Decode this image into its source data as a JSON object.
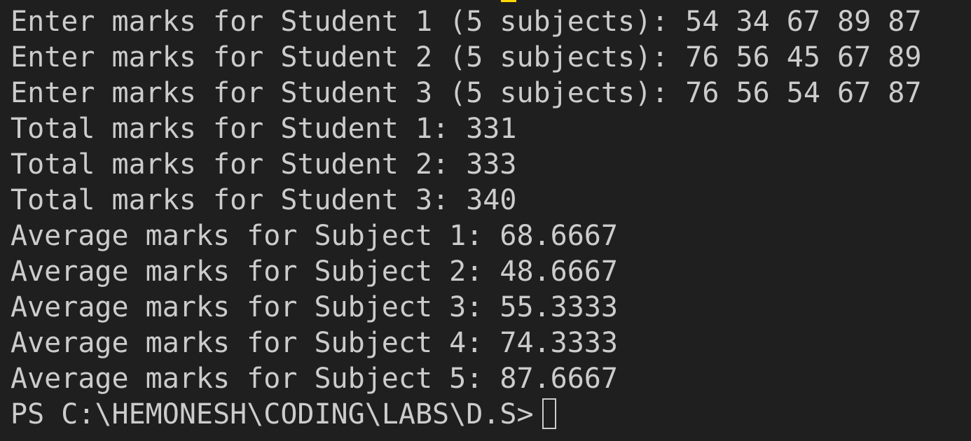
{
  "terminal": {
    "lines": [
      "Enter marks for Student 1 (5 subjects): 54 34 67 89 87",
      "Enter marks for Student 2 (5 subjects): 76 56 45 67 89",
      "Enter marks for Student 3 (5 subjects): 76 56 54 67 87",
      "Total marks for Student 1: 331",
      "Total marks for Student 2: 333",
      "Total marks for Student 3: 340",
      "Average marks for Subject 1: 68.6667",
      "Average marks for Subject 2: 48.6667",
      "Average marks for Subject 3: 55.3333",
      "Average marks for Subject 4: 74.3333",
      "Average marks for Subject 5: 87.6667"
    ],
    "prompt": "PS C:\\HEMONESH\\CODING\\LABS\\D.S>",
    "colors": {
      "background": "#1f1f1f",
      "text": "#cccccc",
      "highlight": "#ffd700"
    },
    "icons": {
      "cursor": "block-cursor-icon"
    }
  }
}
